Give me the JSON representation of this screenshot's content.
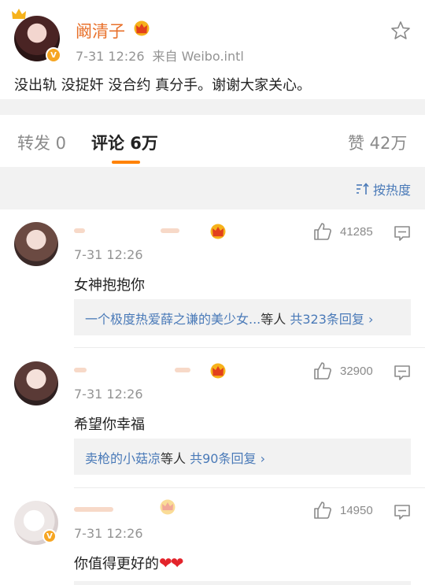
{
  "post": {
    "author": "阚清子",
    "time": "7-31 12:26",
    "source": "来自 Weibo.intl",
    "text": "没出轨 没捉奸 没合约 真分手。谢谢大家关心。",
    "verified_badge": "V"
  },
  "tabs": [
    {
      "label": "转发 0"
    },
    {
      "label": "评论 6万"
    },
    {
      "label": "赞 42万"
    }
  ],
  "sort": {
    "label": "按热度"
  },
  "comments": [
    {
      "time": "7-31 12:26",
      "likes": "41285",
      "text": "女神抱抱你",
      "replies_prefix": "一个极度热爱薛之谦的美少女...",
      "replies_mid": "等人",
      "replies_count": "共323条回复",
      "chevron": "›"
    },
    {
      "time": "7-31 12:26",
      "likes": "32900",
      "text": "希望你幸福",
      "replies_prefix": "卖枪的小菇凉",
      "replies_mid": "等人",
      "replies_count": "共90条回复",
      "chevron": "›"
    },
    {
      "time": "7-31 12:26",
      "likes": "14950",
      "text": "你值得更好的",
      "hearts": "❤❤",
      "verified_badge": "V"
    }
  ],
  "colors": {
    "accent": "#ff8200",
    "name_orange": "#e8702a",
    "link_blue": "#4a7ab8",
    "verified": "#f6a623"
  }
}
